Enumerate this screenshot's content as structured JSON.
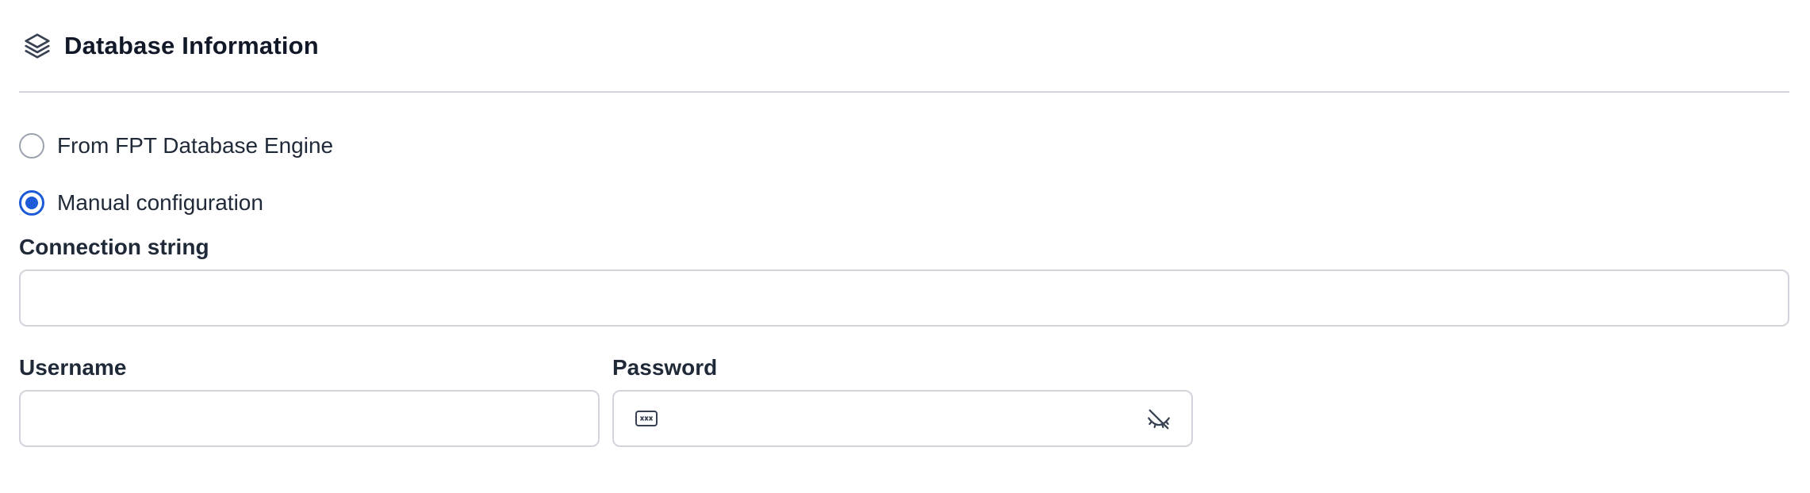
{
  "section": {
    "title": "Database Information",
    "icon": "layers-icon"
  },
  "source_options": [
    {
      "label": "From FPT Database Engine",
      "selected": false
    },
    {
      "label": "Manual configuration",
      "selected": true
    }
  ],
  "fields": {
    "connection_string": {
      "label": "Connection string",
      "value": ""
    },
    "username": {
      "label": "Username",
      "value": ""
    },
    "password": {
      "label": "Password",
      "value": "",
      "leading_icon": "password-icon",
      "toggle_icon": "eye-off-icon"
    }
  },
  "colors": {
    "accent": "#1d5bd8",
    "border": "#d1d5db",
    "text": "#111827"
  }
}
